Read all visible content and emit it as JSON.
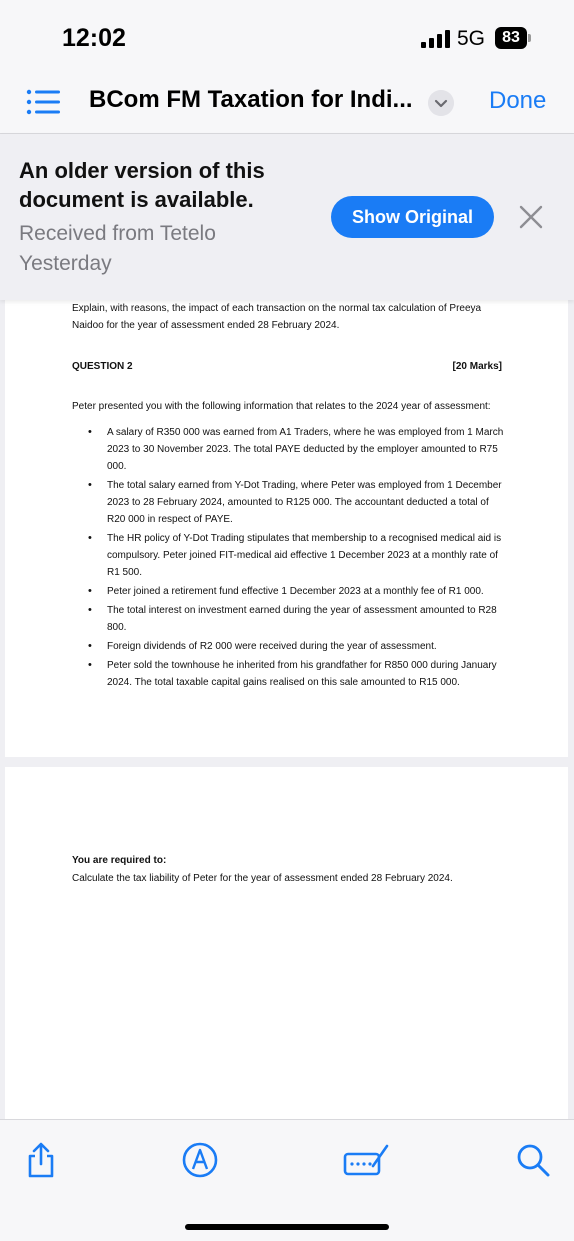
{
  "status_bar": {
    "time": "12:02",
    "network": "5G",
    "battery": "83"
  },
  "nav": {
    "title": "BCom FM Taxation for Indi...",
    "done_label": "Done"
  },
  "banner": {
    "message": "An older version of this document is available.",
    "subtitle": "Received from Tetelo Yesterday",
    "show_original_label": "Show Original"
  },
  "document": {
    "page1": {
      "intro": "Explain, with reasons, the impact of each transaction on the normal tax calculation of Preeya Naidoo for the year of assessment ended 28 February 2024.",
      "question_title": "QUESTION 2",
      "question_marks": "[20 Marks]",
      "lead": "Peter presented you with the following information that relates to the 2024 year of assessment:",
      "bullets": [
        "A salary of R350 000 was earned from A1 Traders, where he was employed from 1 March 2023 to 30 November 2023. The total PAYE deducted by the employer amounted to R75 000.",
        "The total salary earned from Y-Dot Trading, where Peter was employed from 1 December 2023 to 28 February 2024, amounted to R125 000. The accountant deducted a total of R20 000 in respect of PAYE.",
        "The HR policy of Y-Dot Trading stipulates that membership to a recognised medical aid is compulsory. Peter joined FIT-medical aid effective 1 December 2023 at a monthly rate of R1 500.",
        "Peter joined a retirement fund effective 1 December 2023 at a monthly fee of R1 000.",
        "The total interest on investment earned during the year of assessment amounted to R28 800.",
        "Foreign dividends of R2 000 were received during the year of assessment.",
        "Peter sold the townhouse he inherited from his grandfather for R850 000 during January 2024. The total taxable capital gains realised on this sale amounted to R15 000."
      ]
    },
    "page2": {
      "required_heading": "You are required to:",
      "required_text": "Calculate the tax liability of Peter for the year of assessment ended 28 February 2024."
    }
  },
  "toolbar": {
    "icons": [
      "share-icon",
      "markup-icon",
      "keyboard-icon",
      "search-icon"
    ]
  },
  "colors": {
    "accent": "#1a7cf5",
    "background": "#efeff3",
    "muted_text": "#7a7a80"
  }
}
